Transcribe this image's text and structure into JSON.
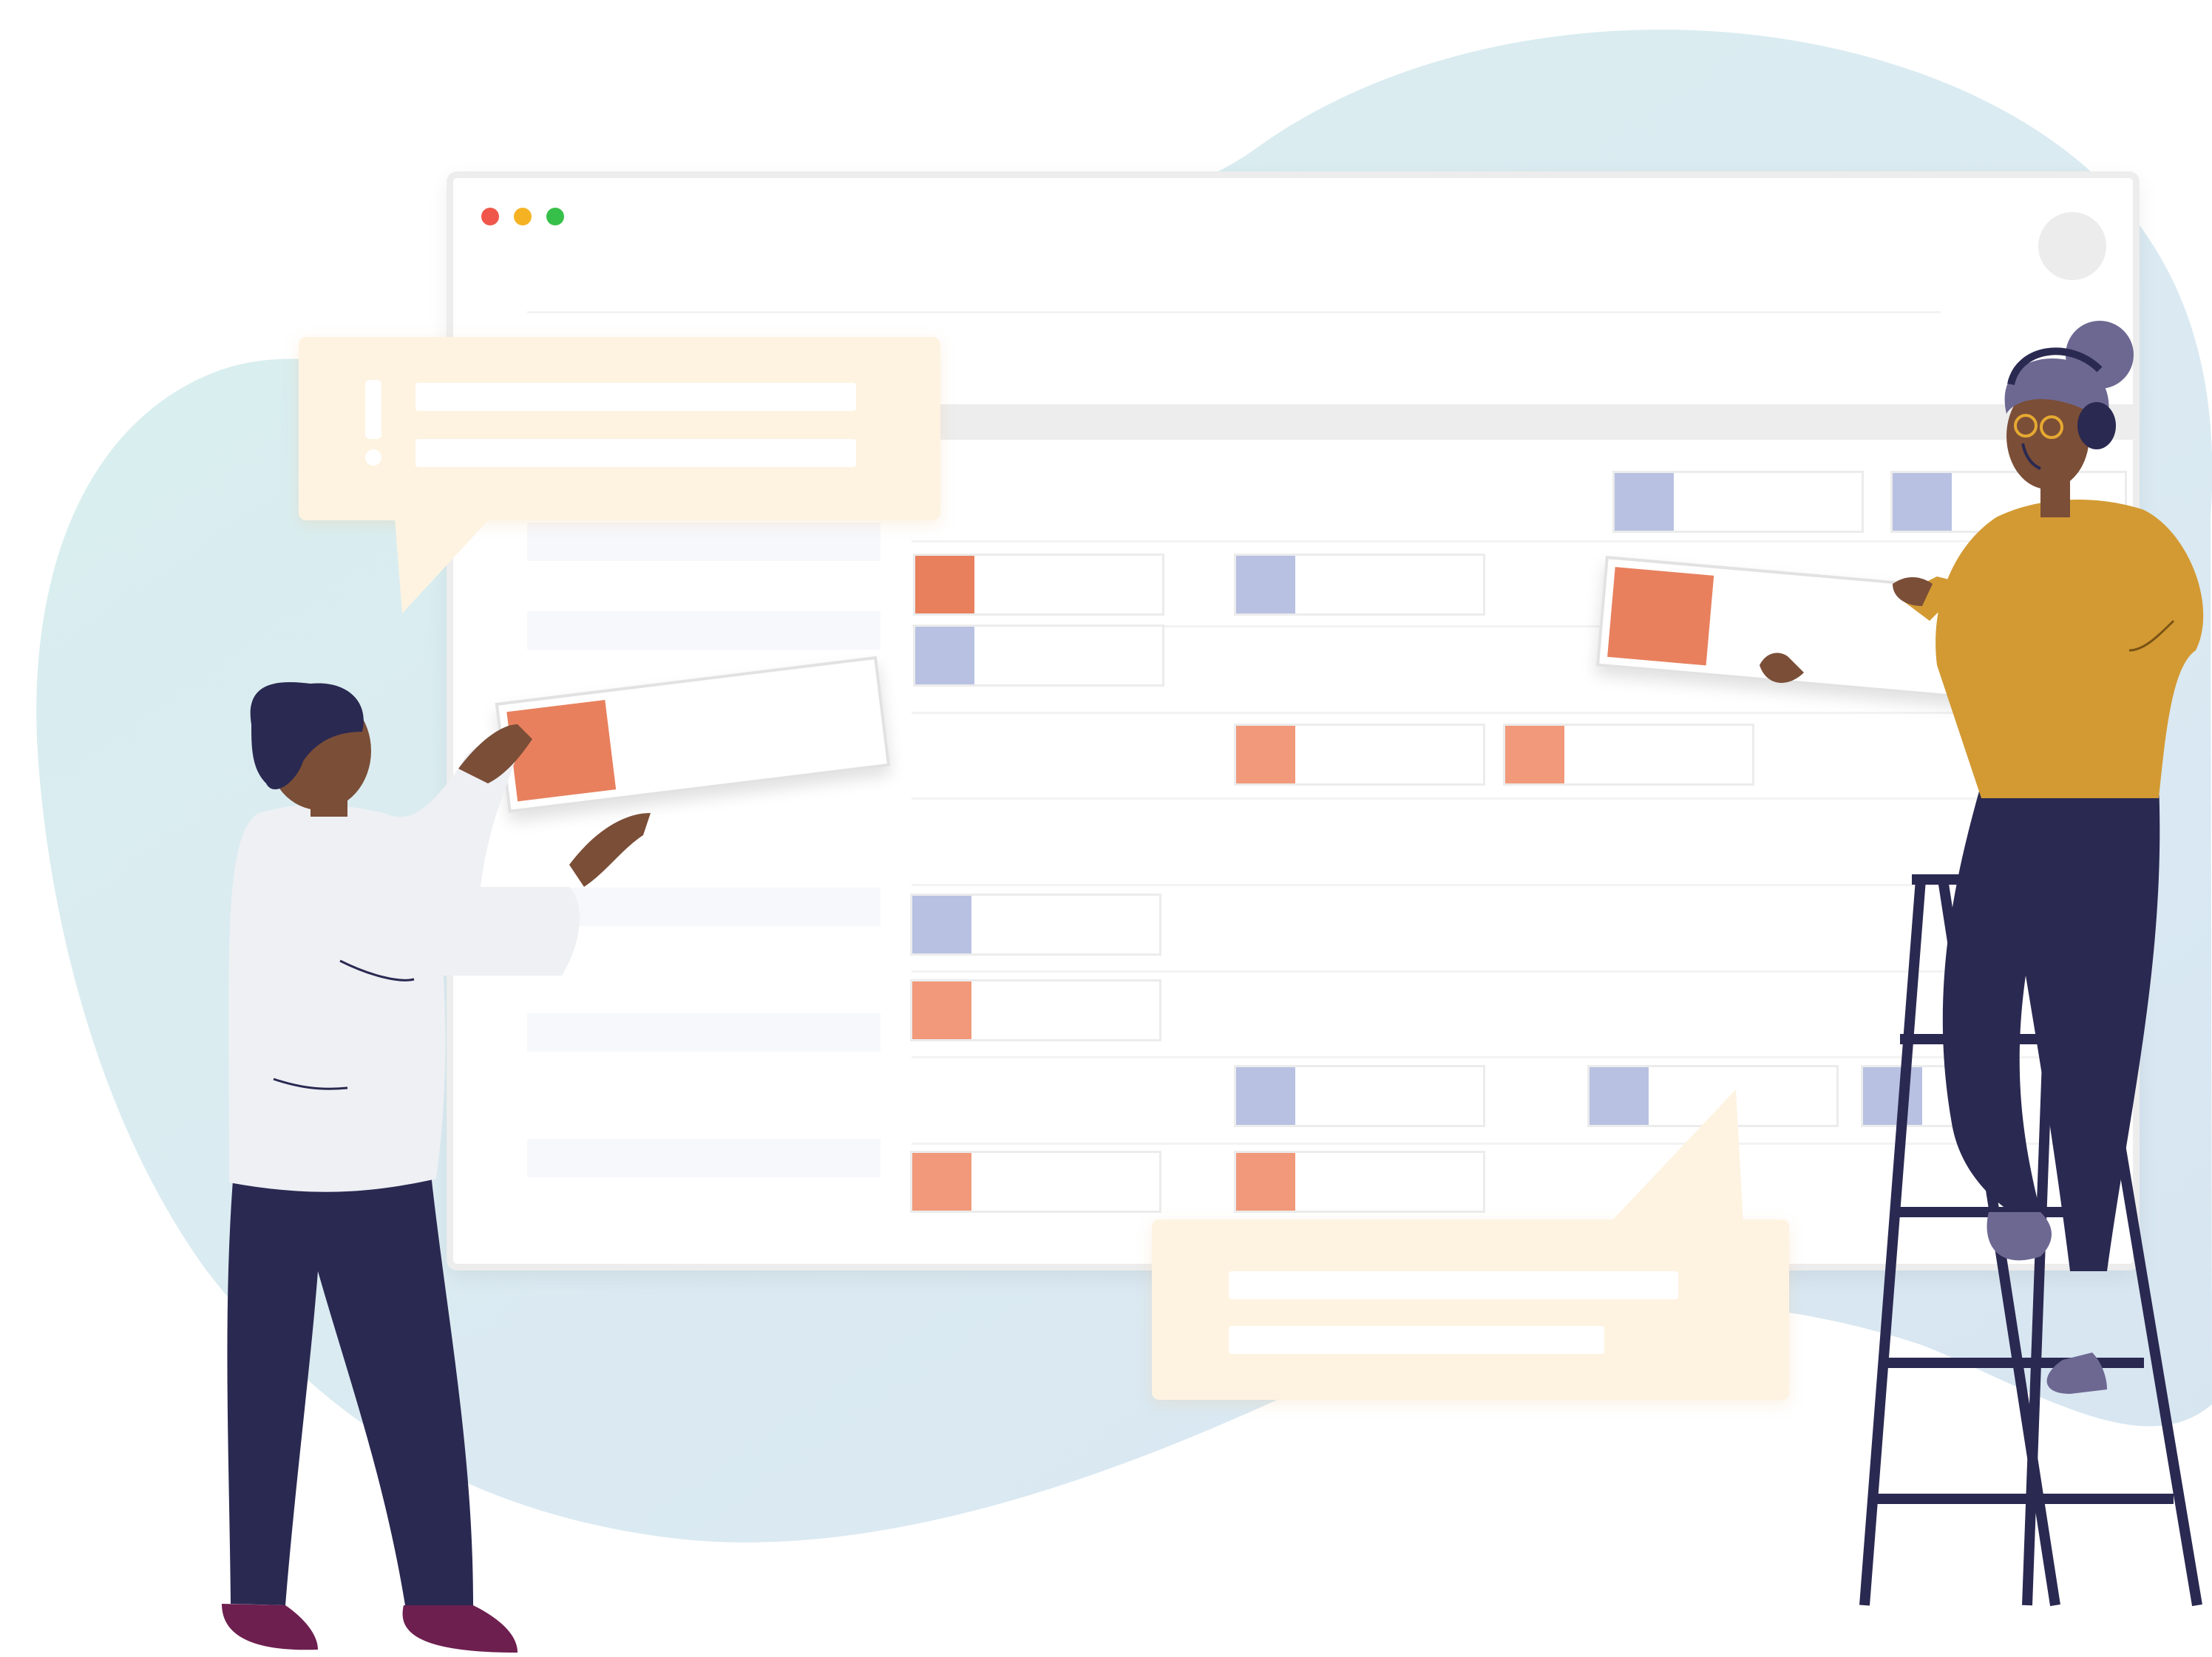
{
  "colors": {
    "blob_blue": "#daeaf2",
    "blob_teal": "#d8efee",
    "accent_orange": "#e8805e",
    "accent_purple": "#b8c1e2",
    "bubble": "#fef3e1",
    "window_border": "#ededed",
    "navy": "#2a2951",
    "mustard": "#d39a33",
    "skin": "#7b4e37",
    "shirt": "#eef0f4",
    "shoes": "#6d1f4f",
    "hair_grey": "#6d6892"
  },
  "icons": {
    "traffic": [
      "close-dot-icon",
      "minimize-dot-icon",
      "maximize-dot-icon"
    ],
    "alert": "exclamation-icon"
  }
}
